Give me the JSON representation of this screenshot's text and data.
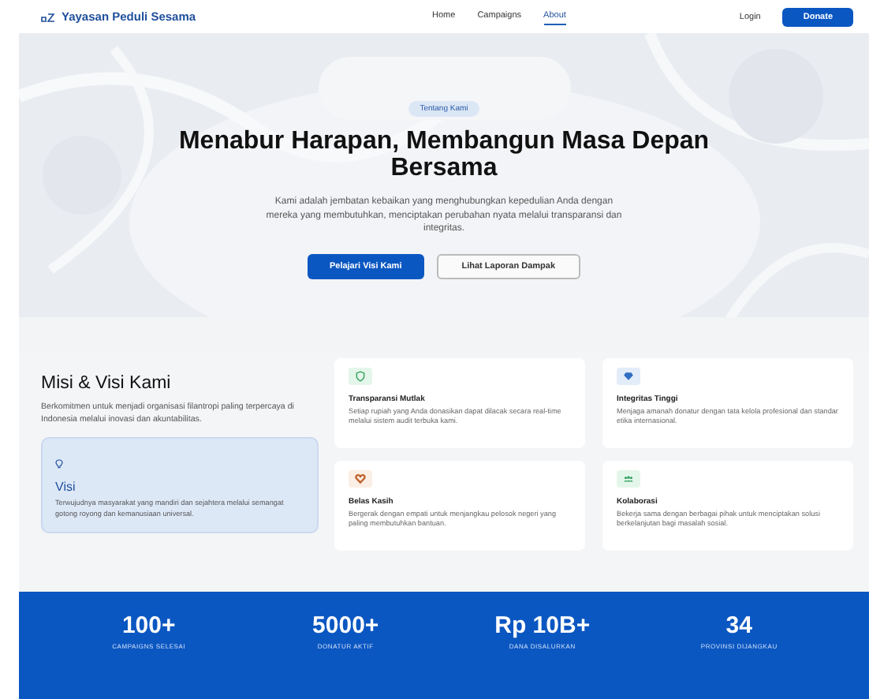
{
  "nav": {
    "brand": "Yayasan Peduli Sesama",
    "links": [
      {
        "label": "Home",
        "selected": false
      },
      {
        "label": "Campaigns",
        "selected": false
      },
      {
        "label": "About",
        "selected": true
      }
    ],
    "login": "Login",
    "donate": "Donate"
  },
  "hero": {
    "kind": "picture",
    "badge": "Tentang Kami",
    "title": "Menabur Harapan, Membangun Masa Depan Bersama",
    "text": "Kami adalah jembatan kebaikan yang menghubungkan kepedulian Anda dengan mereka yang membutuhkan, menciptakan perubahan nyata melalui transparansi dan integritas.",
    "primary_button": "Pelajari Visi Kami",
    "secondary_button": "Lihat Laporan Dampak"
  },
  "mission": {
    "title": "Misi & Visi Kami",
    "text": "Berkomitmen untuk menjadi organisasi filantropi paling terpercaya di Indonesia melalui inovasi dan akuntabilitas.",
    "vision": {
      "title": "Visi",
      "text": "Terwujudnya masyarakat yang mandiri dan sejahtera melalui semangat gotong royong dan kemanusiaan universal."
    },
    "values": [
      {
        "kind": "shield",
        "color": "#2e9e5b",
        "title": "Transparansi Mutlak",
        "text": "Setiap rupiah yang Anda donasikan dapat dilacak secara real-time melalui sistem audit terbuka kami."
      },
      {
        "kind": "diamond",
        "color": "#2f6fc4",
        "title": "Integritas Tinggi",
        "text": "Menjaga amanah donatur dengan tata kelola profesional dan standar etika internasional."
      },
      {
        "kind": "heart",
        "color": "#c0602a",
        "title": "Belas Kasih",
        "text": "Bergerak dengan empati untuk menjangkau pelosok negeri yang paling membutuhkan bantuan."
      },
      {
        "kind": "people",
        "color": "#2e9e5b",
        "title": "Kolaborasi",
        "text": "Bekerja sama dengan berbagai pihak untuk menciptakan solusi berkelanjutan bagi masalah sosial."
      }
    ]
  },
  "stats": [
    {
      "value": "100+",
      "label": "CAMPAIGNS SELESAI"
    },
    {
      "value": "5000+",
      "label": "DONATUR AKTIF"
    },
    {
      "value": "Rp 10B+",
      "label": "DANA DISALURKAN"
    },
    {
      "value": "34",
      "label": "PROVINSI DIJANGKAU"
    }
  ]
}
